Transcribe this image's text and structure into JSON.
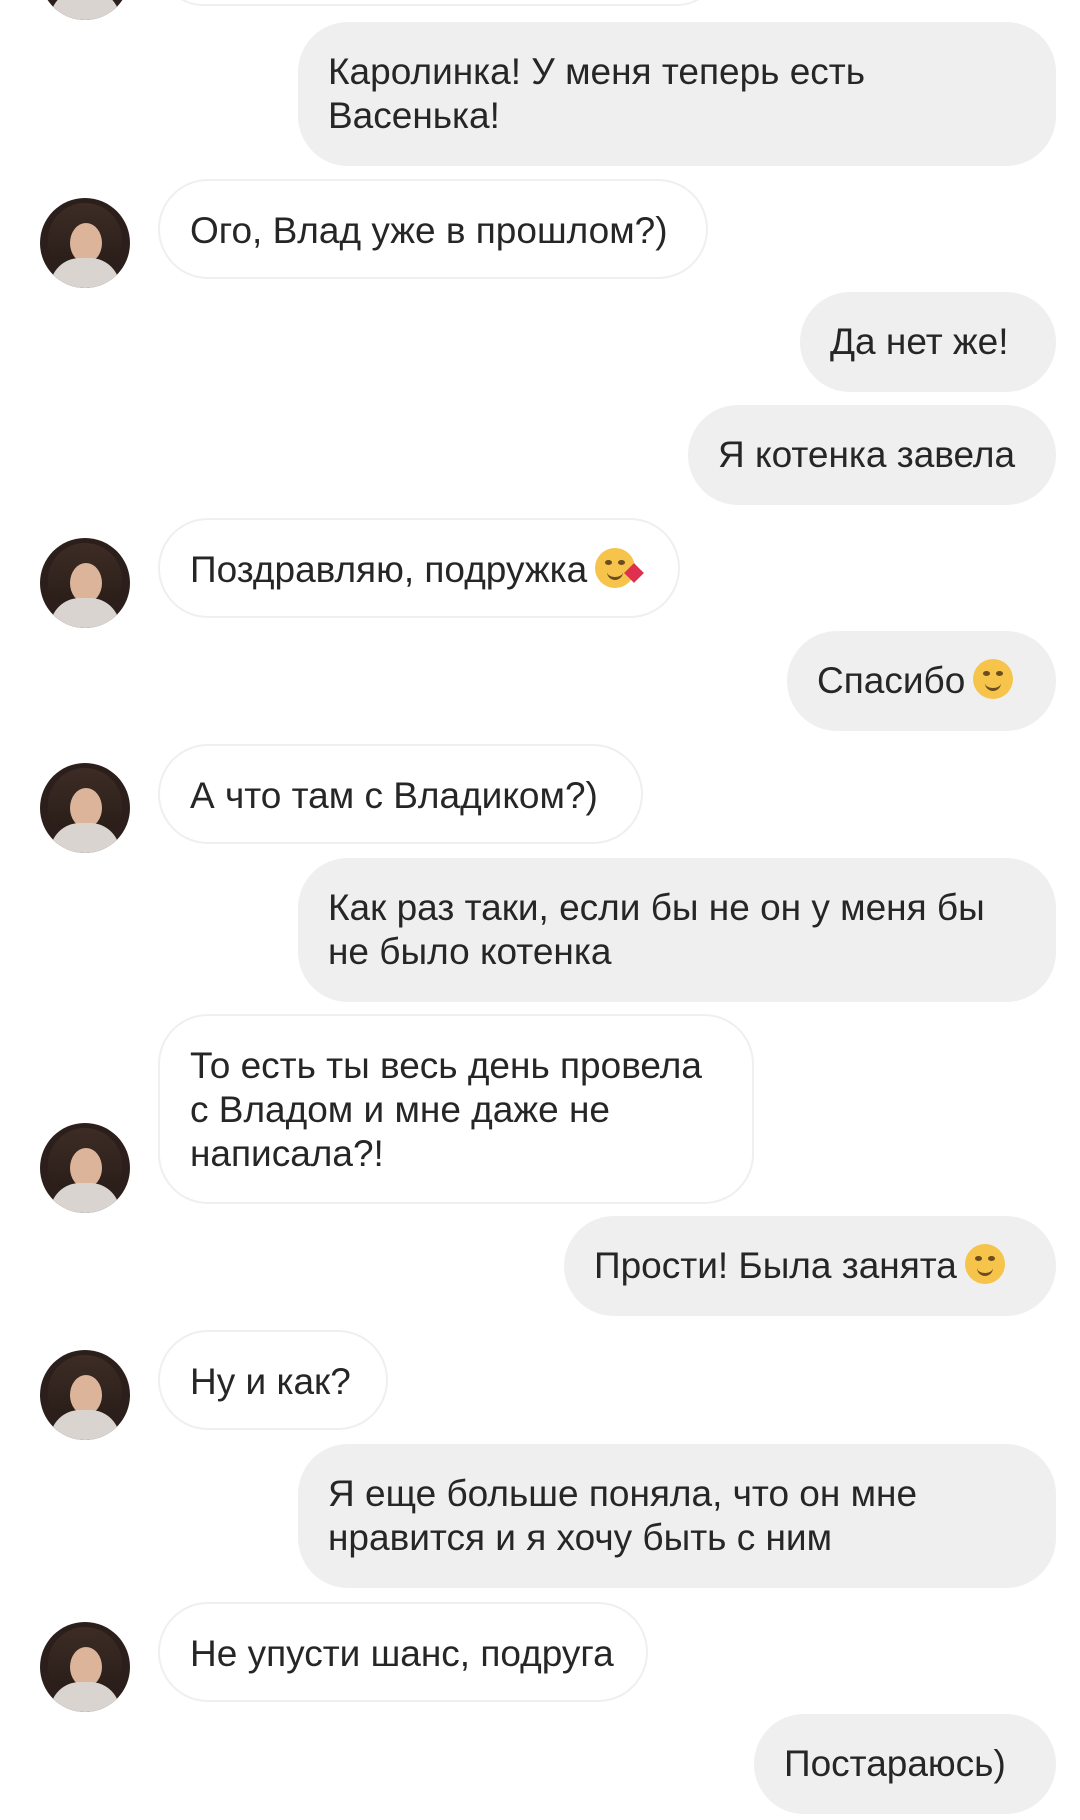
{
  "messages": [
    {
      "side": "out",
      "text": "Каролинка! У меня теперь есть\nВасенька!"
    },
    {
      "side": "in",
      "text": "Ого, Влад уже в прошлом?)"
    },
    {
      "side": "out",
      "text": "Да нет же!"
    },
    {
      "side": "out",
      "text": "Я котенка завела"
    },
    {
      "side": "in",
      "text": "Поздравляю, подружка",
      "emoji": "kissing-face-emoji"
    },
    {
      "side": "out",
      "text": "Спасибо",
      "emoji": "smiling-face-emoji"
    },
    {
      "side": "in",
      "text": "А что там с Владиком?)"
    },
    {
      "side": "out",
      "text": "Как раз таки, если бы не он у меня бы\nне было котенка"
    },
    {
      "side": "in",
      "text": "То есть ты весь день провела\nс Владом и мне даже не\nнаписала?!"
    },
    {
      "side": "out",
      "text": "Прости! Была занята",
      "emoji": "winking-face-emoji"
    },
    {
      "side": "in",
      "text": "Ну и как?"
    },
    {
      "side": "out",
      "text": "Я еще больше поняла, что он мне\nнравится и я хочу быть с ним"
    },
    {
      "side": "in",
      "text": "Не упусти шанс, подруга"
    },
    {
      "side": "out",
      "text": "Постараюсь)"
    }
  ]
}
